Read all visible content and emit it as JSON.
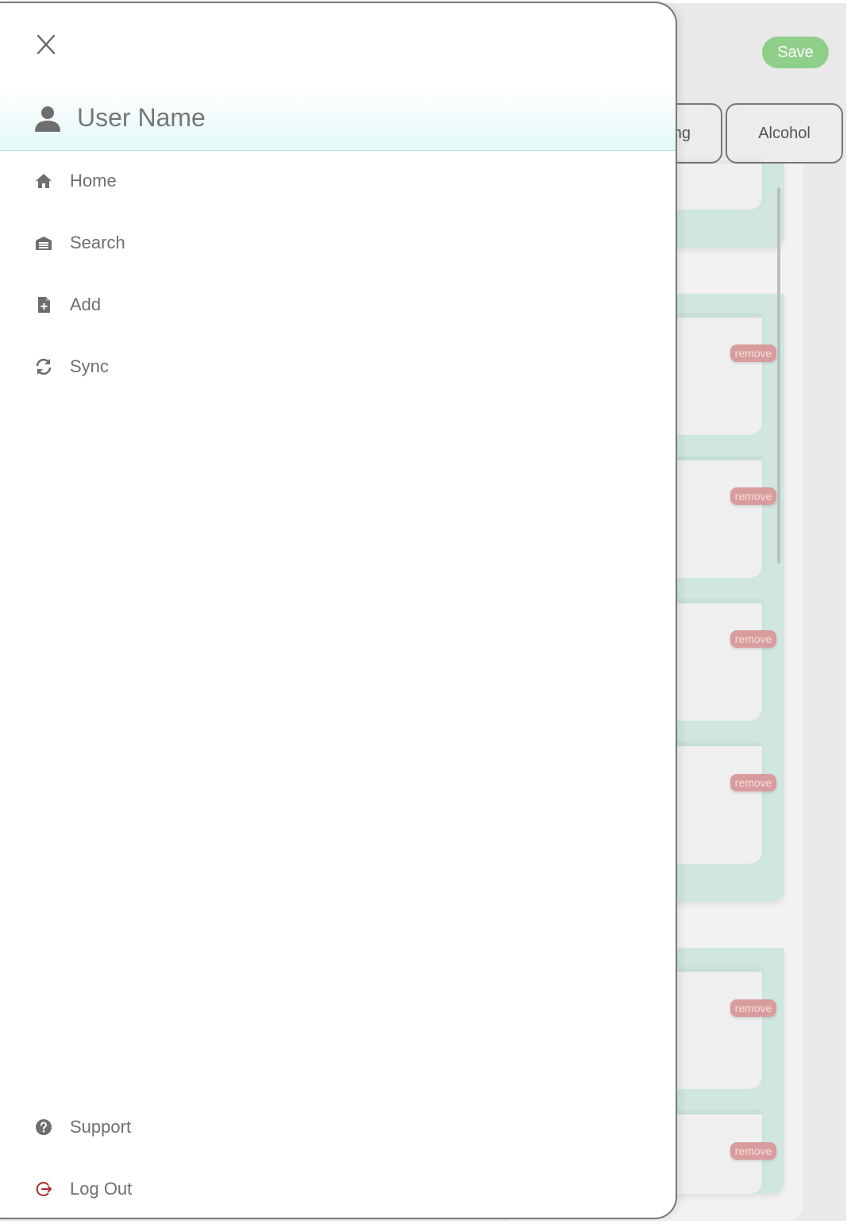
{
  "background": {
    "save_label": "Save",
    "tabs": [
      "ng",
      "Alcohol"
    ],
    "remove_label": "remove"
  },
  "drawer": {
    "user_name": "User Name",
    "nav": [
      {
        "label": "Home",
        "icon": "home-icon"
      },
      {
        "label": "Search",
        "icon": "search-icon"
      },
      {
        "label": "Add",
        "icon": "add-file-icon"
      },
      {
        "label": "Sync",
        "icon": "sync-icon"
      }
    ],
    "footer": [
      {
        "label": "Support",
        "icon": "help-icon"
      },
      {
        "label": "Log Out",
        "icon": "logout-icon"
      }
    ]
  },
  "colors": {
    "logout": "#b02a2a",
    "header_tint": "#e4f8f8",
    "save": "#8fcf8a",
    "remove": "#d99c9c"
  }
}
